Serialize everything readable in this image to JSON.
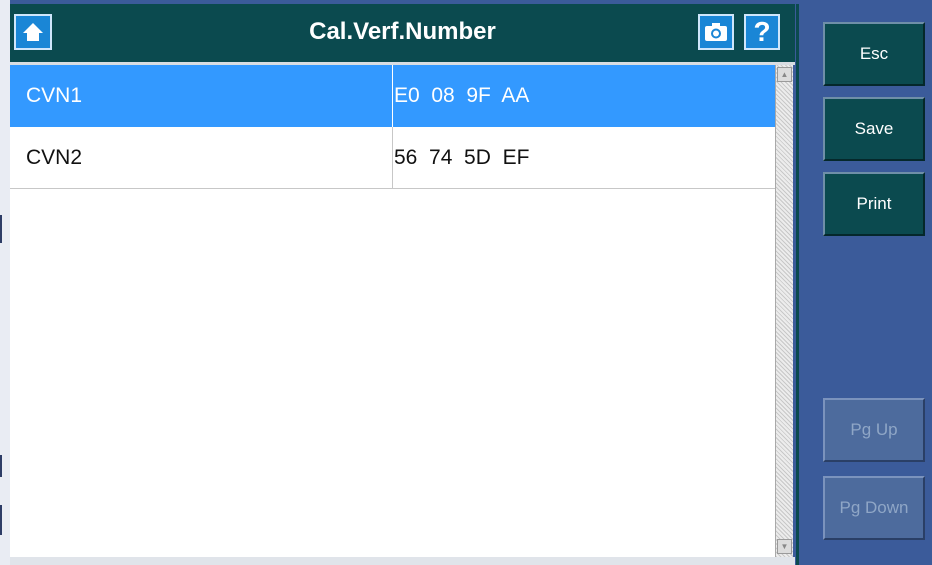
{
  "header": {
    "title": "Cal.Verf.Number",
    "home_icon": "home-icon",
    "camera_icon": "camera-icon",
    "help_label": "?"
  },
  "table": {
    "rows": [
      {
        "name": "CVN1",
        "value": "E0  08  9F  AA",
        "selected": true
      },
      {
        "name": "CVN2",
        "value": "56  74  5D  EF",
        "selected": false
      }
    ]
  },
  "side_buttons": {
    "esc": "Esc",
    "save": "Save",
    "print": "Print",
    "pg_up": "Pg Up",
    "pg_down": "Pg Down"
  },
  "colors": {
    "header_bg": "#0b4a4f",
    "selected_row": "#3399ff",
    "panel_bg": "#3b5b9a"
  }
}
